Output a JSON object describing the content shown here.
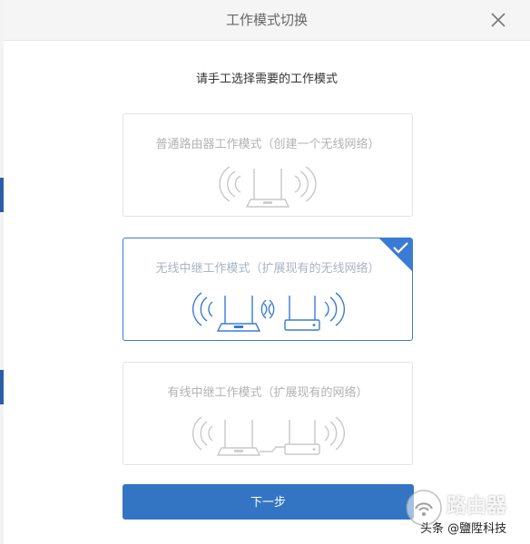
{
  "dialog": {
    "title": "工作模式切换",
    "subtitle": "请手工选择需要的工作模式"
  },
  "modes": [
    {
      "label": "普通路由器工作模式（创建一个无线网络）",
      "selected": false
    },
    {
      "label": "无线中继工作模式（扩展现有的无线网络）",
      "selected": true
    },
    {
      "label": "有线中继工作模式（扩展现有的网络）",
      "selected": false
    }
  ],
  "buttons": {
    "next_label": "下一步"
  },
  "watermark": {
    "brand": "路由器",
    "credit": "头条 @鹽陞科技"
  },
  "colors": {
    "accent": "#3375c3",
    "selected_border": "#3a7bd5",
    "disabled_text": "#b3b3b3"
  },
  "icons": {
    "close": "close-icon",
    "check": "checkmark-icon"
  }
}
